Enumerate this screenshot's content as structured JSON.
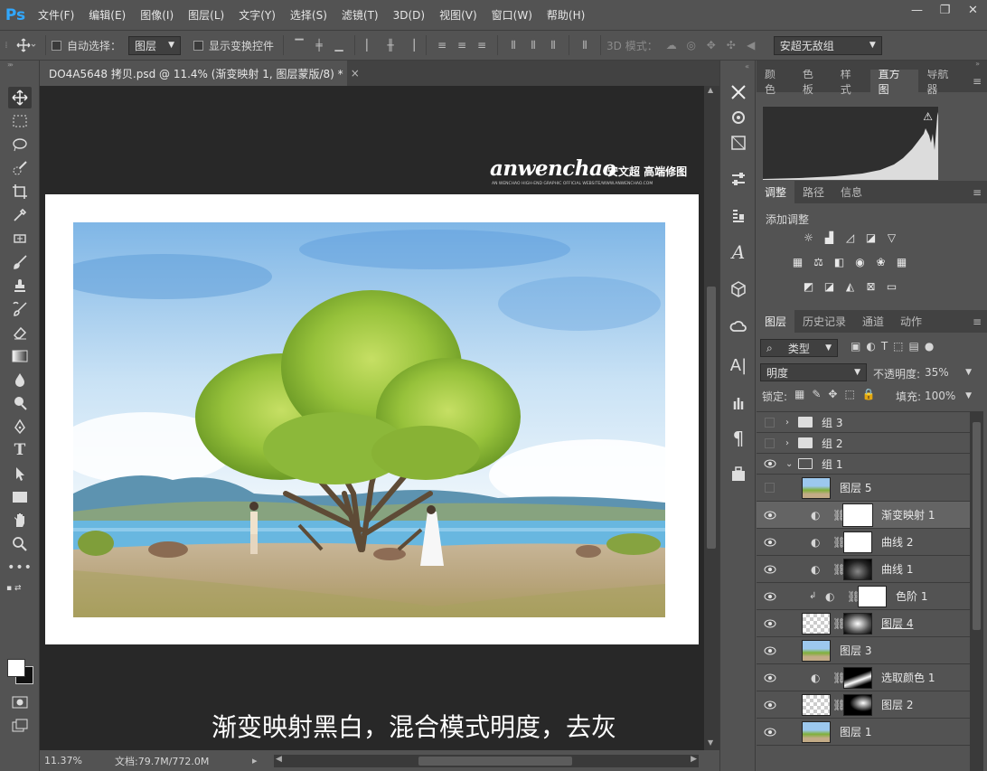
{
  "app": {
    "logo": "Ps"
  },
  "menu": [
    "文件(F)",
    "编辑(E)",
    "图像(I)",
    "图层(L)",
    "文字(Y)",
    "选择(S)",
    "滤镜(T)",
    "3D(D)",
    "视图(V)",
    "窗口(W)",
    "帮助(H)"
  ],
  "window_controls": {
    "minimize": "—",
    "restore": "❐",
    "close": "✕"
  },
  "options": {
    "auto_select_label": "自动选择：",
    "auto_select_value": "图层",
    "show_transform_label": "显示变换控件",
    "mode_3d_label": "3D 模式：",
    "workspace": "安超无敌组"
  },
  "document": {
    "tab_title": "DO4A5648 拷贝.psd @ 11.4% (渐变映射 1, 图层蒙版/8) *",
    "close": "×",
    "watermark_script": "anwenchao",
    "watermark_cn": "安文超 高端修图",
    "watermark_small": "AN WENCHAO HIGH-END GRAPHIC OFFICIAL WEBSITE/WWW.ANWENCHAO.COM",
    "caption": "渐变映射黑白，混合模式明度，去灰"
  },
  "status": {
    "zoom": "11.37%",
    "doc_size": "文档:79.7M/772.0M"
  },
  "histogram_panel": {
    "tabs": [
      "颜色",
      "色板",
      "样式",
      "直方图",
      "导航器"
    ],
    "active_tab": "直方图"
  },
  "adjust_panel": {
    "tabs": [
      "调整",
      "路径",
      "信息"
    ],
    "active_tab": "调整",
    "heading": "添加调整"
  },
  "layers_panel": {
    "tabs": [
      "图层",
      "历史记录",
      "通道",
      "动作"
    ],
    "active_tab": "图层",
    "filter_kind": "类型",
    "blend_mode": "明度",
    "opacity_label": "不透明度:",
    "opacity_value": "35%",
    "lock_label": "锁定:",
    "fill_label": "填充:",
    "fill_value": "100%",
    "layers": [
      {
        "name": "组 3",
        "visible": false
      },
      {
        "name": "组 2",
        "visible": false
      },
      {
        "name": "组 1",
        "visible": true
      },
      {
        "name": "图层 5",
        "visible": false
      },
      {
        "name": "渐变映射 1",
        "visible": true
      },
      {
        "name": "曲线 2",
        "visible": true
      },
      {
        "name": "曲线 1",
        "visible": true
      },
      {
        "name": "色阶 1",
        "visible": true
      },
      {
        "name": "图层 4",
        "visible": true
      },
      {
        "name": "图层 3",
        "visible": true
      },
      {
        "name": "选取颜色 1",
        "visible": true
      },
      {
        "name": "图层 2",
        "visible": true
      },
      {
        "name": "图层 1",
        "visible": true
      }
    ]
  }
}
